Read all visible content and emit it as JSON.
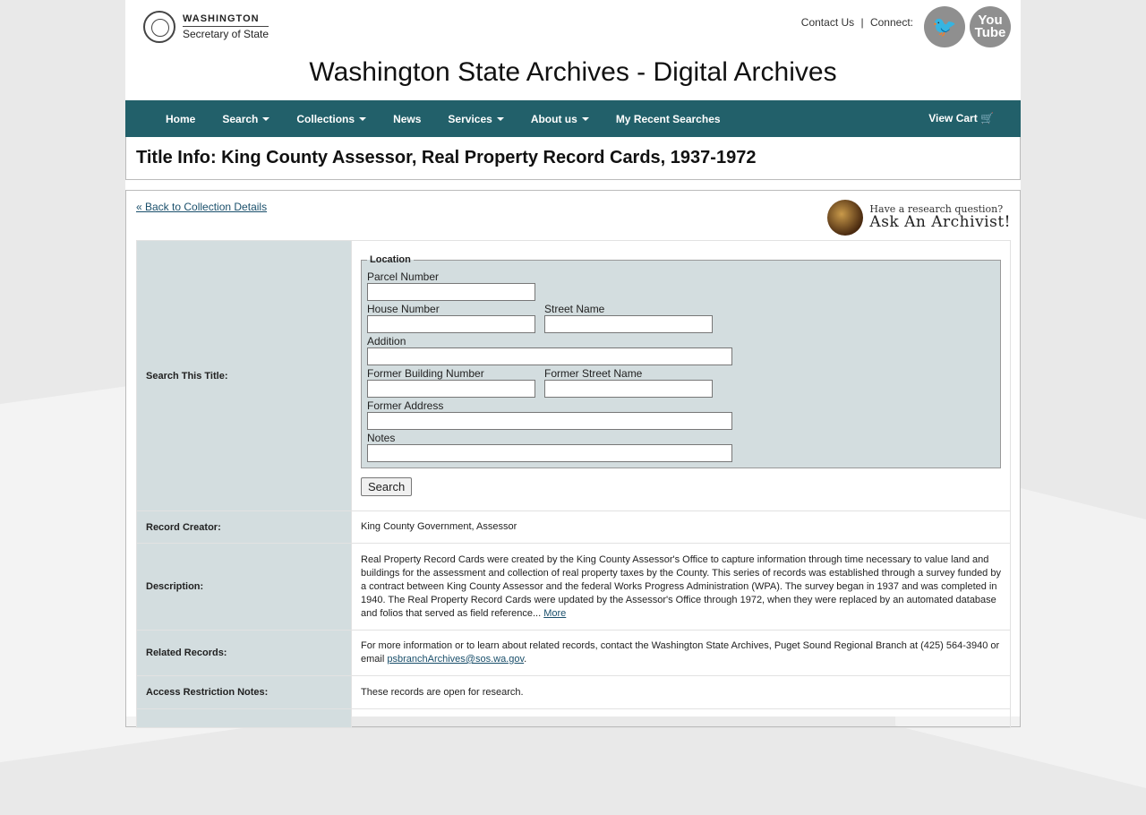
{
  "header": {
    "logo_line1": "WASHINGTON",
    "logo_line2": "Secretary of State",
    "contact_link": "Contact Us",
    "separator": "|",
    "connect_label": "Connect:",
    "twitter_glyph": "🐦",
    "youtube_label": "You Tube",
    "site_title": "Washington State Archives - Digital Archives"
  },
  "nav": {
    "items": [
      {
        "label": "Home"
      },
      {
        "label": "Search"
      },
      {
        "label": "Collections"
      },
      {
        "label": "News"
      },
      {
        "label": "Services"
      },
      {
        "label": "About us"
      },
      {
        "label": "My Recent Searches"
      }
    ],
    "cart": "View Cart 🛒"
  },
  "page_title": "Title Info: King County Assessor, Real Property Record Cards, 1937-1972",
  "back_link": "« Back to Collection Details",
  "ask": {
    "line1": "Have a research question?",
    "line2": "Ask An Archivist!"
  },
  "search": {
    "label": "Search This Title:",
    "legend": "Location",
    "fields": {
      "parcel": "Parcel Number",
      "house": "House Number",
      "street": "Street Name",
      "addition": "Addition",
      "former_building": "Former Building Number",
      "former_street": "Former Street Name",
      "former_address": "Former Address",
      "notes": "Notes"
    },
    "button": "Search"
  },
  "rows": {
    "creator_label": "Record Creator:",
    "creator_value": "King County Government, Assessor",
    "description_label": "Description:",
    "description_value": "Real Property Record Cards were created by the King County Assessor's Office to capture information through time necessary to value land and buildings for the assessment and collection of real property taxes by the County. This series of records was established through a survey funded by a contract between King County Assessor and the federal Works Progress Administration (WPA). The survey began in 1937 and was completed in 1940. The Real Property Record Cards were updated by the Assessor's Office through 1972, when they were replaced by an automated database and folios that served as field reference...",
    "description_more": "More",
    "related_label": "Related Records:",
    "related_value": "For more information or to learn about related records, contact the Washington State Archives, Puget Sound Regional Branch at (425) 564-3940 or email",
    "related_email": "psbranchArchives@sos.wa.gov",
    "related_end": ".",
    "access_label": "Access Restriction Notes:",
    "access_value": "These records are open for research."
  },
  "colors": {
    "nav": "#22606a",
    "label_bg": "#d3dddf",
    "link": "#1a4f6b"
  }
}
